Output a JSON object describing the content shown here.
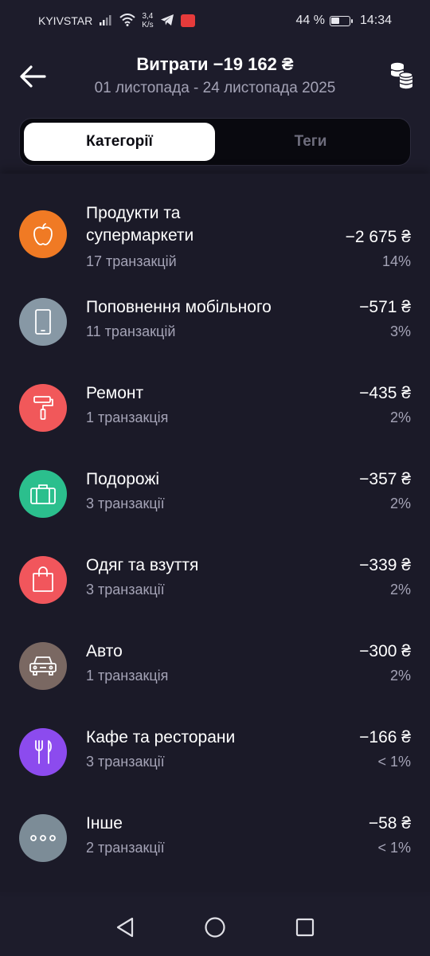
{
  "status_bar": {
    "carrier": "KYIVSTAR",
    "net_speed_value": "3,4",
    "net_speed_unit": "K/s",
    "battery_percent": "44 %",
    "battery_level": 0.44,
    "time": "14:34"
  },
  "header": {
    "title": "Витрати −19 162 ₴",
    "period": "01 листопада - 24 листопада 2025",
    "back_icon": "arrow-left-icon",
    "coins_icon": "coins-stack-icon"
  },
  "tabs": [
    {
      "label": "Категорії",
      "active": true
    },
    {
      "label": "Теги",
      "active": false
    }
  ],
  "categories": [
    {
      "name_line1": "Продукти та",
      "name_line2": "супермаркети",
      "count": "17 транзакцій",
      "amount": "−2 675 ₴",
      "percent": "14%",
      "icon": "apple-icon",
      "color": "#f07a24"
    },
    {
      "name_line1": "Поповнення мобільного",
      "count": "11 транзакцій",
      "amount": "−571 ₴",
      "percent": "3%",
      "icon": "phone-icon",
      "color": "#8798a5"
    },
    {
      "name_line1": "Ремонт",
      "count": "1 транзакція",
      "amount": "−435 ₴",
      "percent": "2%",
      "icon": "paint-roller-icon",
      "color": "#f1585a"
    },
    {
      "name_line1": "Подорожі",
      "count": "3 транзакції",
      "amount": "−357 ₴",
      "percent": "2%",
      "icon": "suitcase-icon",
      "color": "#2bbf8d"
    },
    {
      "name_line1": "Одяг та взуття",
      "count": "3 транзакції",
      "amount": "−339 ₴",
      "percent": "2%",
      "icon": "shopping-bag-icon",
      "color": "#f1565c"
    },
    {
      "name_line1": "Авто",
      "count": "1 транзакція",
      "amount": "−300 ₴",
      "percent": "2%",
      "icon": "car-icon",
      "color": "#7a6862"
    },
    {
      "name_line1": "Кафе та ресторани",
      "count": "3 транзакції",
      "amount": "−166 ₴",
      "percent": "< 1%",
      "icon": "fork-knife-icon",
      "color": "#8c4bee"
    },
    {
      "name_line1": "Інше",
      "count": "2 транзакції",
      "amount": "−58 ₴",
      "percent": "< 1%",
      "icon": "more-dots-icon",
      "color": "#7c8c97"
    }
  ]
}
